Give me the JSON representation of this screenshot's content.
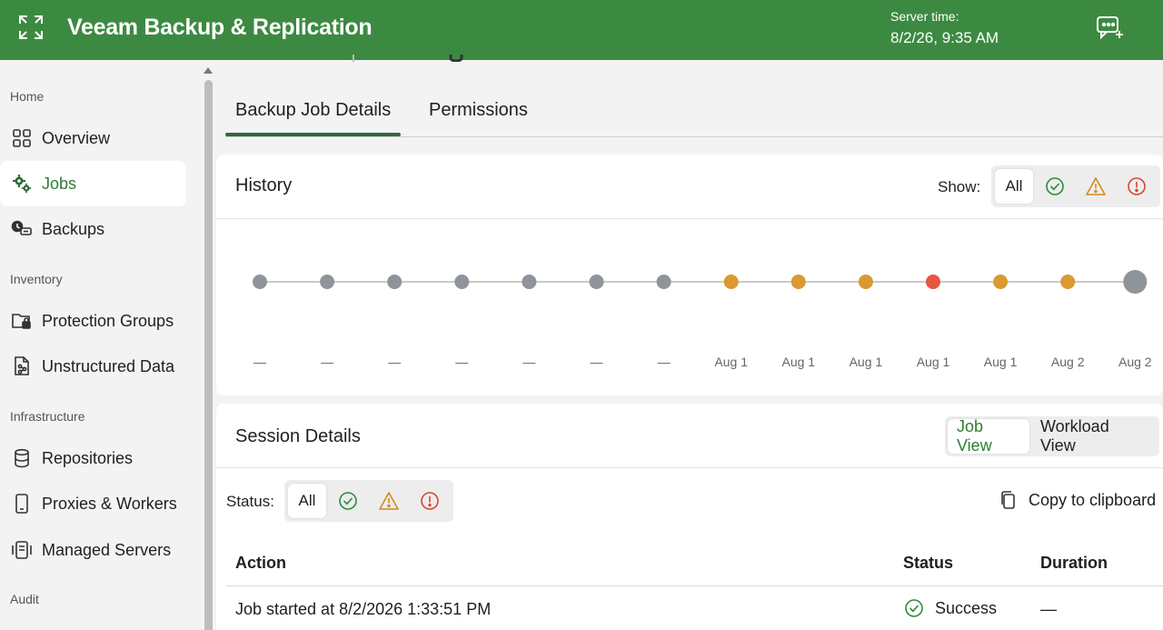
{
  "header": {
    "app_title": "Veeam Backup & Replication",
    "server_time_label": "Server time:",
    "server_time_value": "8/2/26, 9:35 AM",
    "brand_color": "#3c8a41"
  },
  "sidebar": {
    "sections": [
      "Home",
      "Inventory",
      "Infrastructure",
      "Audit"
    ],
    "items": [
      {
        "label": "Overview",
        "icon": "grid-icon"
      },
      {
        "label": "Jobs",
        "icon": "gears-icon",
        "active": true
      },
      {
        "label": "Backups",
        "icon": "backups-icon"
      },
      {
        "label": "Protection Groups",
        "icon": "folder-lock-icon"
      },
      {
        "label": "Unstructured Data",
        "icon": "file-share-icon"
      },
      {
        "label": "Repositories",
        "icon": "database-icon"
      },
      {
        "label": "Proxies & Workers",
        "icon": "phone-device-icon"
      },
      {
        "label": "Managed Servers",
        "icon": "servers-icon"
      }
    ]
  },
  "tabs": [
    {
      "label": "Backup Job Details",
      "active": true
    },
    {
      "label": "Permissions",
      "active": false
    }
  ],
  "history": {
    "title": "History",
    "show_label": "Show:",
    "filters": [
      "All",
      "success-icon",
      "warning-icon",
      "error-icon"
    ],
    "selected_filter": "All",
    "points": [
      {
        "status": "none",
        "label": "—"
      },
      {
        "status": "none",
        "label": "—"
      },
      {
        "status": "none",
        "label": "—"
      },
      {
        "status": "none",
        "label": "—"
      },
      {
        "status": "none",
        "label": "—"
      },
      {
        "status": "none",
        "label": "—"
      },
      {
        "status": "none",
        "label": "—"
      },
      {
        "status": "warning",
        "label": "Aug 1"
      },
      {
        "status": "warning",
        "label": "Aug 1"
      },
      {
        "status": "warning",
        "label": "Aug 1"
      },
      {
        "status": "error",
        "label": "Aug 1"
      },
      {
        "status": "warning",
        "label": "Aug 1"
      },
      {
        "status": "warning",
        "label": "Aug 2"
      },
      {
        "status": "current",
        "label": "Aug 2"
      }
    ],
    "colors": {
      "none": "#8f949a",
      "warning": "#d99a30",
      "error": "#e8553f",
      "current": "#8f949a"
    }
  },
  "session": {
    "title": "Session Details",
    "views": [
      "Job View",
      "Workload View"
    ],
    "selected_view": "Job View",
    "status_label": "Status:",
    "status_filters": [
      "All",
      "success-icon",
      "warning-icon",
      "error-icon"
    ],
    "copy_label": "Copy to clipboard",
    "columns": [
      "Action",
      "Status",
      "Duration"
    ],
    "rows": [
      {
        "action": "Job started at 8/2/2026 1:33:51 PM",
        "status": "Success",
        "duration": "—"
      }
    ]
  }
}
